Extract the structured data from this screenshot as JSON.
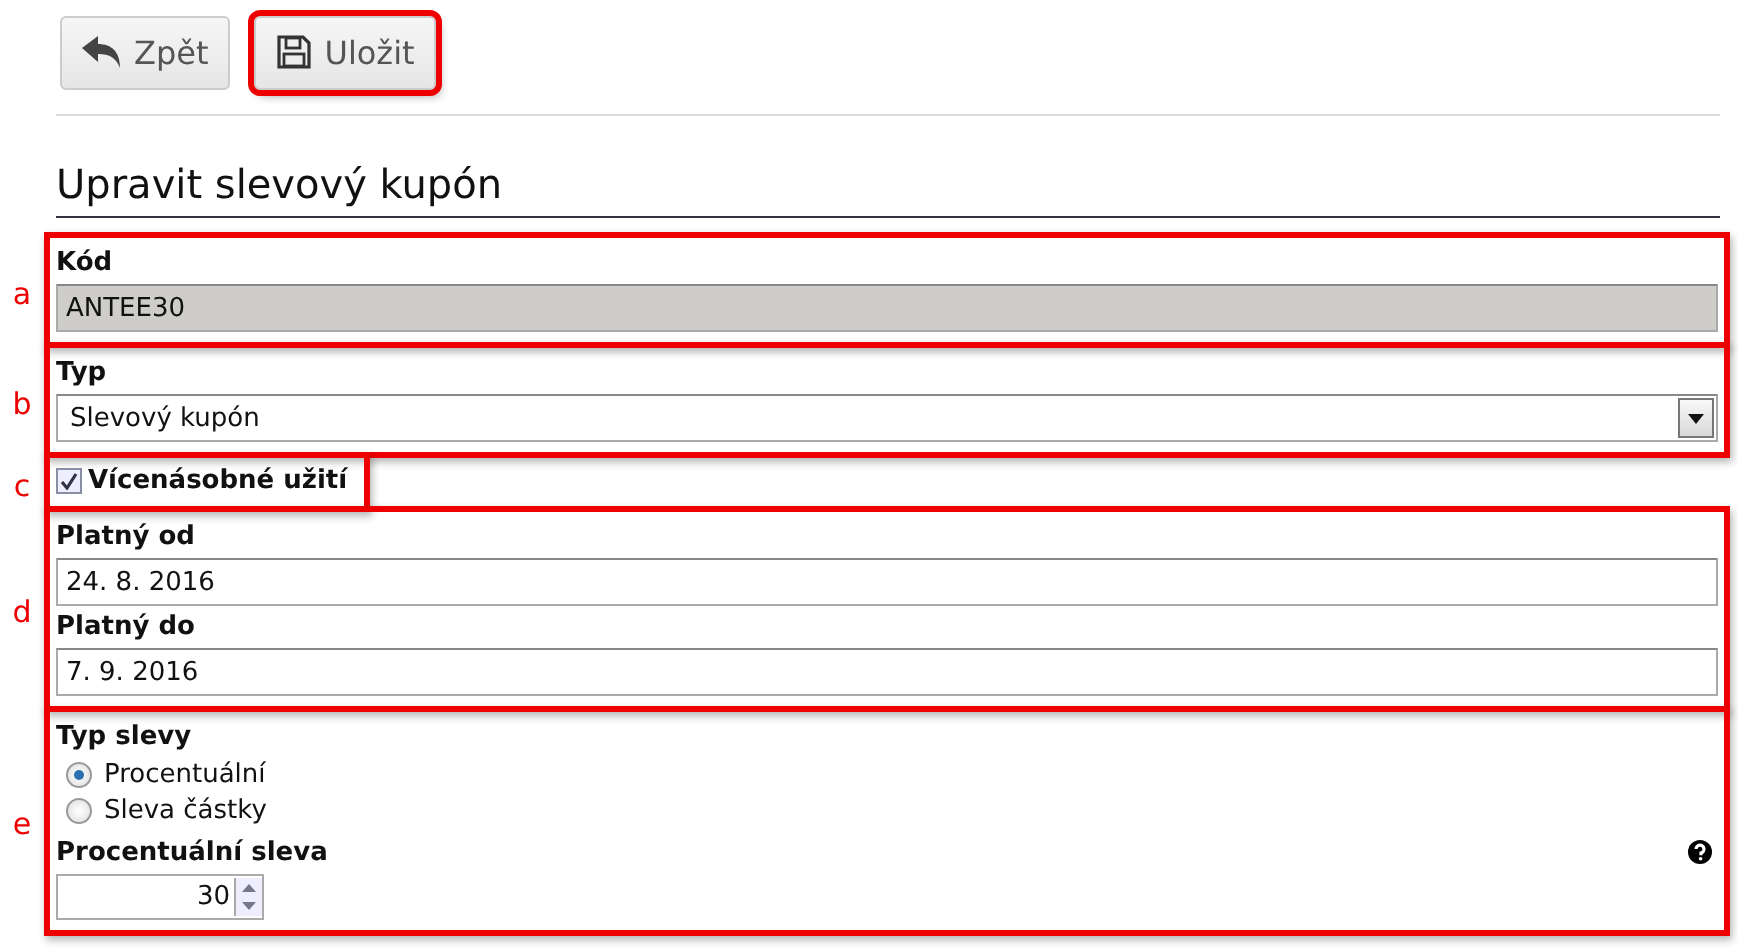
{
  "toolbar": [
    {
      "kind": "back",
      "label": "Zpět",
      "highlighted": false
    },
    {
      "kind": "save",
      "label": "Uložit",
      "highlighted": true
    }
  ],
  "heading": "Upravit slevový kupón",
  "sections": [
    {
      "annotation": "a",
      "fields": [
        {
          "kind": "text",
          "label": "Kód",
          "value": "ANTEE30",
          "disabled": true
        }
      ]
    },
    {
      "annotation": "b",
      "fields": [
        {
          "kind": "select",
          "label": "Typ",
          "value": "Slevový kupón"
        }
      ]
    },
    {
      "annotation": "c",
      "fields": [
        {
          "kind": "checkbox",
          "label": "Vícenásobné užití",
          "checked": true
        }
      ]
    },
    {
      "annotation": "d",
      "fields": [
        {
          "kind": "text",
          "label": "Platný od",
          "value": "24. 8. 2016",
          "disabled": false
        },
        {
          "kind": "text",
          "label": "Platný do",
          "value": "7. 9. 2016",
          "disabled": false
        }
      ]
    },
    {
      "annotation": "e",
      "fields": [
        {
          "kind": "radio",
          "label": "Typ slevy",
          "options": [
            {
              "label": "Procentuální",
              "selected": true
            },
            {
              "label": "Sleva částky",
              "selected": false
            }
          ]
        },
        {
          "kind": "number",
          "label": "Procentuální sleva",
          "value": "30",
          "help": true
        }
      ]
    }
  ]
}
